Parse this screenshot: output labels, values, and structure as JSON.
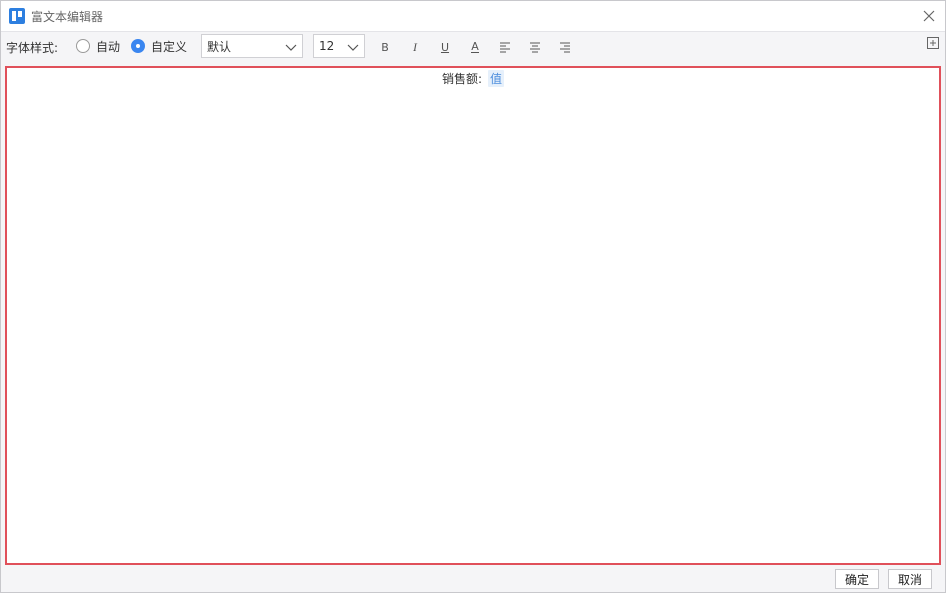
{
  "window": {
    "title": "富文本编辑器"
  },
  "toolbar": {
    "style_label": "字体样式:",
    "radio_auto": {
      "label": "自动",
      "checked": false
    },
    "radio_custom": {
      "label": "自定义",
      "checked": true
    },
    "font_family": "默认",
    "font_size": "12",
    "bold": "B",
    "italic": "I",
    "underline": "U",
    "color": "A"
  },
  "editor": {
    "label": "销售额:",
    "token": "值"
  },
  "footer": {
    "ok_label": "确定",
    "cancel_label": "取消"
  },
  "colors": {
    "accent": "#3a86f0",
    "editor_border": "#e0505a",
    "token_bg": "#e6f0fb",
    "token_text": "#4a8cdc"
  },
  "icons": {
    "logo": "app-logo-icon",
    "close": "close-icon",
    "dropdown": "chevron-down-icon",
    "expand": "expand-icon"
  }
}
